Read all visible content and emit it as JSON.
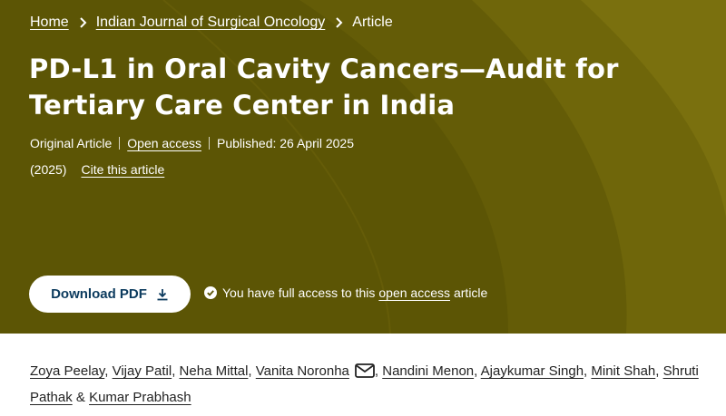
{
  "breadcrumb": {
    "home": "Home",
    "journal": "Indian Journal of Surgical Oncology",
    "current": "Article"
  },
  "article": {
    "title": "PD-L1 in Oral Cavity Cancers—Audit for Tertiary Care Center in India",
    "type": "Original Article",
    "open_access": "Open access",
    "published": "Published: 26 April 2025",
    "year": "(2025)",
    "cite": "Cite this article"
  },
  "actions": {
    "download_label": "Download PDF",
    "access_prefix": "You have full access to this",
    "access_link": "open access",
    "access_suffix": "article"
  },
  "authors": {
    "list": [
      "Zoya Peelay",
      "Vijay Patil",
      "Neha Mittal",
      "Vanita Noronha",
      "Nandini Menon",
      "Ajaykumar Singh",
      "Minit Shah",
      "Shruti Pathak",
      "Kumar Prabhash"
    ],
    "separator": ",",
    "conjunction": "&"
  },
  "icons": {
    "chevron": "chevron-right-icon",
    "download": "download-icon",
    "check": "check-circle-icon",
    "mail": "envelope-icon"
  },
  "colors": {
    "hero_bg": "#5c5505",
    "button_text": "#0c3b5e"
  }
}
